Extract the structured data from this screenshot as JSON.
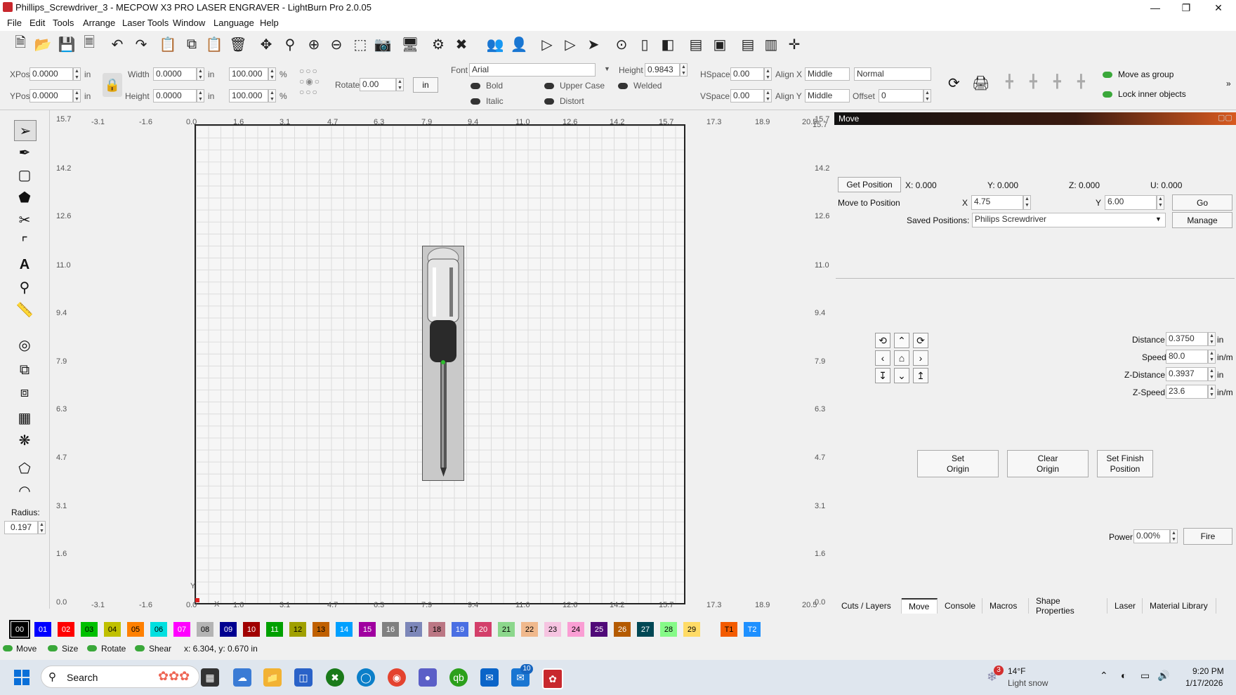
{
  "title": "Phillips_Screwdriver_3 - MECPOW X3 PRO LASER ENGRAVER - LightBurn Pro 2.0.05",
  "menu": [
    "File",
    "Edit",
    "Tools",
    "Arrange",
    "Laser Tools",
    "Window",
    "Language",
    "Help"
  ],
  "props": {
    "xpos_label": "XPos",
    "xpos": "0.0000",
    "ypos_label": "YPos",
    "ypos": "0.0000",
    "unit_in": "in",
    "width_label": "Width",
    "width": "0.0000",
    "height_label": "Height",
    "height": "0.0000",
    "scale_w": "100.000",
    "scale_h": "100.000",
    "pct": "%",
    "rotate_label": "Rotate",
    "rotate": "0.00",
    "units_btn": "in",
    "font_label": "Font",
    "font": "Arial",
    "fheight_label": "Height",
    "fheight": "0.9843",
    "bold": "Bold",
    "upper": "Upper Case",
    "welded": "Welded",
    "italic": "Italic",
    "distort": "Distort",
    "hspace_label": "HSpace",
    "hspace": "0.00",
    "vspace_label": "VSpace",
    "vspace": "0.00",
    "alignx_label": "Align X",
    "alignx": "Middle",
    "aligny_label": "Align Y",
    "aligny": "Middle",
    "normal": "Normal",
    "offset_label": "Offset",
    "offset": "0",
    "move_group": "Move as group",
    "lock_inner": "Lock inner objects"
  },
  "toolbox": {
    "radius_label": "Radius:",
    "radius": "0.197"
  },
  "ruler": {
    "top": [
      "-3.1",
      "-1.6",
      "0.0",
      "1.6",
      "3.1",
      "4.7",
      "6.3",
      "7.9",
      "9.4",
      "11.0",
      "12.6",
      "14.2",
      "15.7",
      "17.3",
      "18.9",
      "20.5"
    ],
    "left": [
      "15.7",
      "14.2",
      "12.6",
      "11.0",
      "9.4",
      "7.9",
      "6.3",
      "4.7",
      "3.1",
      "1.6",
      "0.0"
    ],
    "right": [
      "15.7",
      "14.2",
      "12.6",
      "11.0",
      "9.4",
      "7.9",
      "6.3",
      "4.7",
      "3.1",
      "1.6",
      "0.0"
    ],
    "top_right_extra": "15.7",
    "axis_y": "Y",
    "axis_x": "X"
  },
  "move_panel": {
    "header": "Move",
    "get_position": "Get Position",
    "x_read": "X: 0.000",
    "y_read": "Y: 0.000",
    "z_read": "Z: 0.000",
    "u_read": "U: 0.000",
    "move_to": "Move to Position",
    "x_label": "X",
    "x_val": "4.75",
    "y_label": "Y",
    "y_val": "6.00",
    "go": "Go",
    "saved_label": "Saved Positions:",
    "saved_val": "Philips Screwdriver",
    "manage": "Manage",
    "distance_label": "Distance",
    "distance": "0.3750",
    "distance_unit": "in",
    "speed_label": "Speed",
    "speed": "80.0",
    "speed_unit": "in/m",
    "zdist_label": "Z-Distance",
    "zdist": "0.3937",
    "zdist_unit": "in",
    "zspeed_label": "Z-Speed",
    "zspeed": "23.6",
    "zspeed_unit": "in/m",
    "set_origin": "Set\nOrigin",
    "clear_origin": "Clear\nOrigin",
    "set_finish": "Set Finish\nPosition",
    "power_label": "Power",
    "power": "0.00%",
    "fire": "Fire"
  },
  "tabs": [
    "Cuts / Layers",
    "Move",
    "Console",
    "Macros",
    "Shape Properties",
    "Laser",
    "Material Library"
  ],
  "active_tab": "Move",
  "palette": [
    {
      "n": "00",
      "c": "#000000",
      "t": "#fff"
    },
    {
      "n": "01",
      "c": "#0000ff",
      "t": "#fff"
    },
    {
      "n": "02",
      "c": "#ff0000",
      "t": "#fff"
    },
    {
      "n": "03",
      "c": "#00c000",
      "t": "#000"
    },
    {
      "n": "04",
      "c": "#c0c000",
      "t": "#000"
    },
    {
      "n": "05",
      "c": "#ff8000",
      "t": "#000"
    },
    {
      "n": "06",
      "c": "#00e0e0",
      "t": "#000"
    },
    {
      "n": "07",
      "c": "#ff00ff",
      "t": "#fff"
    },
    {
      "n": "08",
      "c": "#b4b4b4",
      "t": "#000"
    },
    {
      "n": "09",
      "c": "#000090",
      "t": "#fff"
    },
    {
      "n": "10",
      "c": "#a00000",
      "t": "#fff"
    },
    {
      "n": "11",
      "c": "#00a000",
      "t": "#fff"
    },
    {
      "n": "12",
      "c": "#a0a000",
      "t": "#000"
    },
    {
      "n": "13",
      "c": "#c06000",
      "t": "#000"
    },
    {
      "n": "14",
      "c": "#00a0ff",
      "t": "#fff"
    },
    {
      "n": "15",
      "c": "#a000a0",
      "t": "#fff"
    },
    {
      "n": "16",
      "c": "#808080",
      "t": "#fff"
    },
    {
      "n": "17",
      "c": "#7d87b9",
      "t": "#000"
    },
    {
      "n": "18",
      "c": "#bb7784",
      "t": "#000"
    },
    {
      "n": "19",
      "c": "#4a6fe3",
      "t": "#fff"
    },
    {
      "n": "20",
      "c": "#d33f6a",
      "t": "#fff"
    },
    {
      "n": "21",
      "c": "#8cd78c",
      "t": "#000"
    },
    {
      "n": "22",
      "c": "#f0b98d",
      "t": "#000"
    },
    {
      "n": "23",
      "c": "#f6c4e1",
      "t": "#000"
    },
    {
      "n": "24",
      "c": "#fa9ed4",
      "t": "#000"
    },
    {
      "n": "25",
      "c": "#500a78",
      "t": "#fff"
    },
    {
      "n": "26",
      "c": "#b45a00",
      "t": "#fff"
    },
    {
      "n": "27",
      "c": "#004754",
      "t": "#fff"
    },
    {
      "n": "28",
      "c": "#86fa88",
      "t": "#000"
    },
    {
      "n": "29",
      "c": "#ffdb66",
      "t": "#000"
    },
    {
      "n": "T1",
      "c": "#f35b00",
      "t": "#000"
    },
    {
      "n": "T2",
      "c": "#1e90ff",
      "t": "#fff"
    }
  ],
  "status": {
    "move": "Move",
    "size": "Size",
    "rotate": "Rotate",
    "shear": "Shear",
    "coords": "x: 6.304, y: 0.670 in"
  },
  "taskbar": {
    "search": "Search",
    "weather_temp": "14°F",
    "weather_desc": "Light snow",
    "weather_badge": "3",
    "outlook_badge": "10",
    "time": "9:20 PM",
    "date": "1/17/2026"
  }
}
